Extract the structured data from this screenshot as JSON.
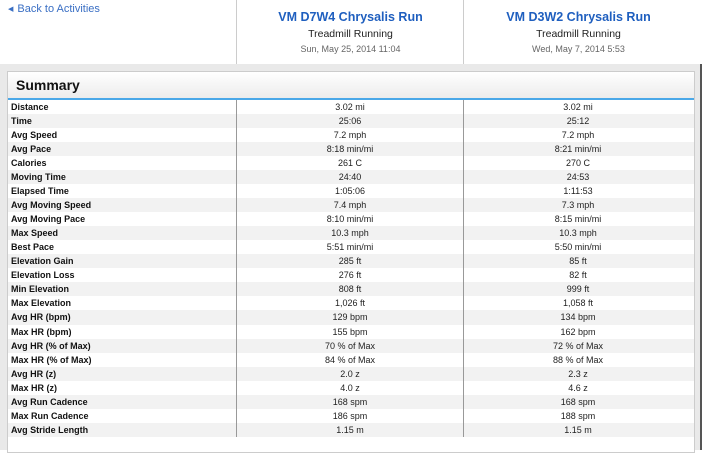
{
  "back_link": "Back to Activities",
  "activities": [
    {
      "title": "VM D7W4 Chrysalis Run",
      "type": "Treadmill Running",
      "date": "Sun, May 25, 2014 11:04"
    },
    {
      "title": "VM D3W2 Chrysalis Run",
      "type": "Treadmill Running",
      "date": "Wed, May 7, 2014 5:53"
    }
  ],
  "summary": {
    "title": "Summary",
    "rows": [
      {
        "label": "Distance",
        "a": "3.02 mi",
        "b": "3.02 mi"
      },
      {
        "label": "Time",
        "a": "25:06",
        "b": "25:12"
      },
      {
        "label": "Avg Speed",
        "a": "7.2 mph",
        "b": "7.2 mph"
      },
      {
        "label": "Avg Pace",
        "a": "8:18 min/mi",
        "b": "8:21 min/mi"
      },
      {
        "label": "Calories",
        "a": "261 C",
        "b": "270 C"
      },
      {
        "label": "Moving Time",
        "a": "24:40",
        "b": "24:53"
      },
      {
        "label": "Elapsed Time",
        "a": "1:05:06",
        "b": "1:11:53"
      },
      {
        "label": "Avg Moving Speed",
        "a": "7.4 mph",
        "b": "7.3 mph"
      },
      {
        "label": "Avg Moving Pace",
        "a": "8:10 min/mi",
        "b": "8:15 min/mi"
      },
      {
        "label": "Max Speed",
        "a": "10.3 mph",
        "b": "10.3 mph"
      },
      {
        "label": "Best Pace",
        "a": "5:51 min/mi",
        "b": "5:50 min/mi"
      },
      {
        "label": "Elevation Gain",
        "a": "285 ft",
        "b": "85 ft"
      },
      {
        "label": "Elevation Loss",
        "a": "276 ft",
        "b": "82 ft"
      },
      {
        "label": "Min Elevation",
        "a": "808 ft",
        "b": "999 ft"
      },
      {
        "label": "Max Elevation",
        "a": "1,026 ft",
        "b": "1,058 ft"
      },
      {
        "label": "Avg HR (bpm)",
        "a": "129 bpm",
        "b": "134 bpm"
      },
      {
        "label": "Max HR (bpm)",
        "a": "155 bpm",
        "b": "162 bpm"
      },
      {
        "label": "Avg HR (% of Max)",
        "a": "70 % of Max",
        "b": "72 % of Max"
      },
      {
        "label": "Max HR (% of Max)",
        "a": "84 % of Max",
        "b": "88 % of Max"
      },
      {
        "label": "Avg HR (z)",
        "a": "2.0 z",
        "b": "2.3 z"
      },
      {
        "label": "Max HR (z)",
        "a": "4.0 z",
        "b": "4.6 z"
      },
      {
        "label": "Avg Run Cadence",
        "a": "168 spm",
        "b": "168 spm"
      },
      {
        "label": "Max Run Cadence",
        "a": "186 spm",
        "b": "188 spm"
      },
      {
        "label": "Avg Stride Length",
        "a": "1.15 m",
        "b": "1.15 m"
      }
    ]
  }
}
